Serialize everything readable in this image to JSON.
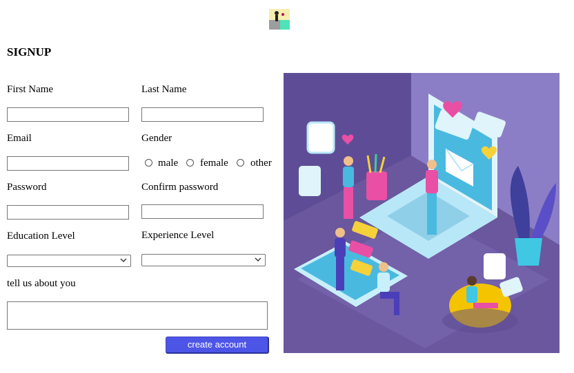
{
  "logo": {
    "icon": "logo-icon"
  },
  "form": {
    "title": "SIGNUP",
    "first_name": {
      "label": "First Name",
      "value": ""
    },
    "last_name": {
      "label": "Last Name",
      "value": ""
    },
    "email": {
      "label": "Email",
      "value": ""
    },
    "gender": {
      "label": "Gender",
      "options": [
        "male",
        "female",
        "other"
      ]
    },
    "password": {
      "label": "Password",
      "value": ""
    },
    "confirm_password": {
      "label": "Confirm password",
      "value": ""
    },
    "education_level": {
      "label": "Education Level",
      "selected": ""
    },
    "experience_level": {
      "label": "Experience Level",
      "selected": ""
    },
    "about": {
      "label": "tell us about you",
      "value": ""
    },
    "submit_label": "create account"
  },
  "colors": {
    "button": "#4d55e6",
    "illustration_bg": "#6f5ea8",
    "accent_pink": "#ea4fa8",
    "accent_cyan": "#3fc7e4"
  },
  "illustration": {
    "icon": "team-laptop-illustration"
  }
}
